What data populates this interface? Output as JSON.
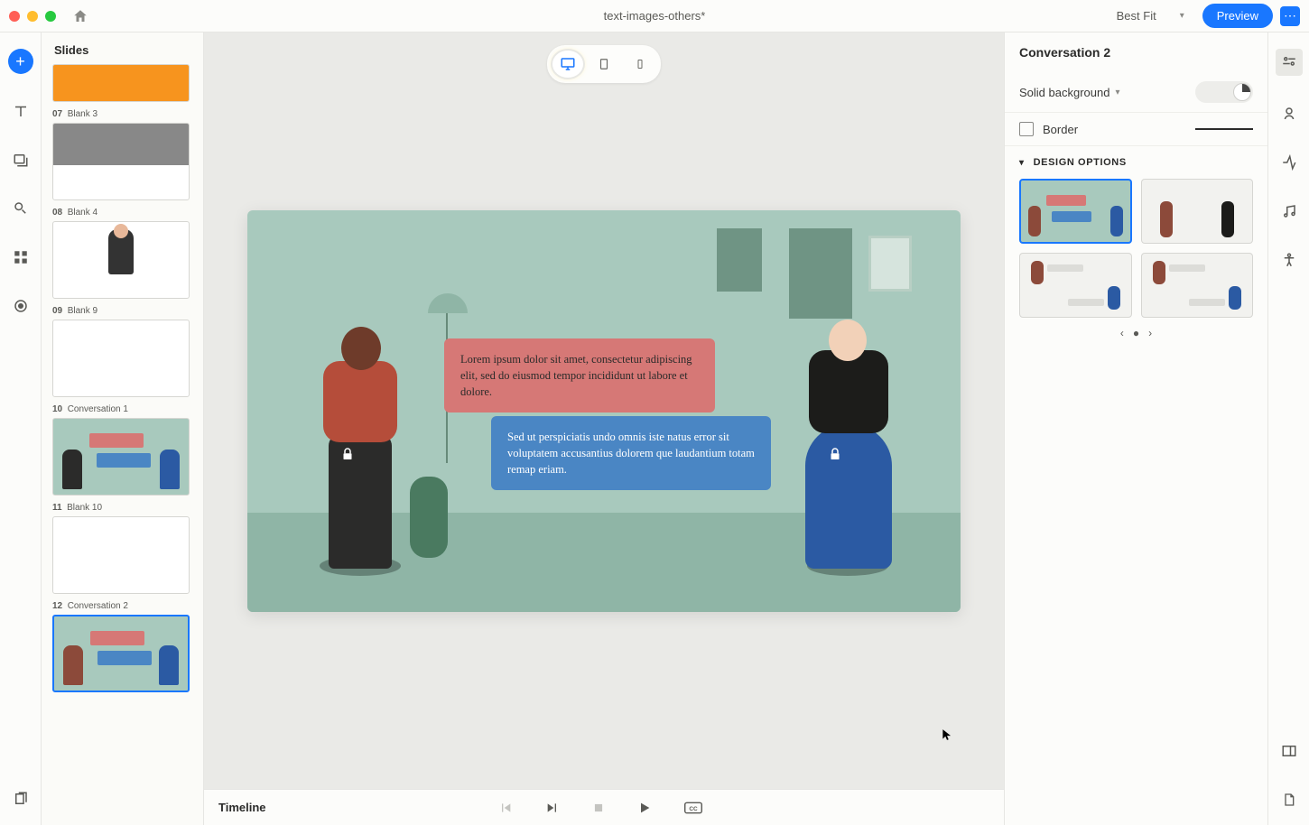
{
  "titlebar": {
    "title": "text-images-others*",
    "zoom": "Best Fit",
    "preview": "Preview"
  },
  "slidePanel": {
    "header": "Slides",
    "items": [
      {
        "num": "",
        "name": "",
        "variant": "orange"
      },
      {
        "num": "07",
        "name": "Blank 3",
        "variant": "photo"
      },
      {
        "num": "08",
        "name": "Blank 4",
        "variant": "person"
      },
      {
        "num": "09",
        "name": "Blank 9",
        "variant": "empty"
      },
      {
        "num": "10",
        "name": "Conversation 1",
        "variant": "conv"
      },
      {
        "num": "11",
        "name": "Blank 10",
        "variant": "empty"
      },
      {
        "num": "12",
        "name": "Conversation 2",
        "variant": "conv",
        "selected": true
      }
    ]
  },
  "canvas": {
    "bubble1": "Lorem ipsum dolor sit amet, consectetur adipiscing elit, sed do eiusmod tempor incididunt ut labore et dolore.",
    "bubble2": "Sed ut perspiciatis undo omnis iste natus error sit voluptatem accusantius dolorem que laudantium totam remap eriam."
  },
  "timeline": {
    "label": "Timeline"
  },
  "props": {
    "title": "Conversation 2",
    "bgLabel": "Solid background",
    "borderLabel": "Border",
    "designHeader": "DESIGN OPTIONS"
  }
}
